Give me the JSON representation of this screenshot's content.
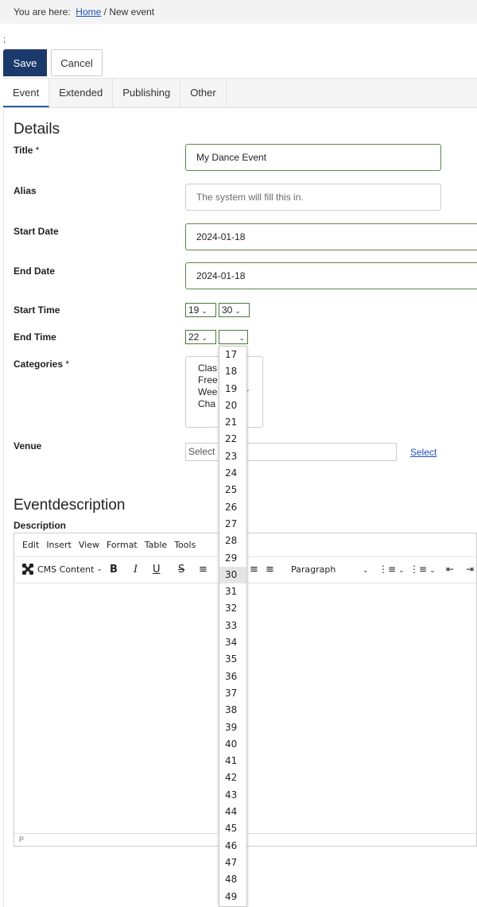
{
  "breadcrumb": {
    "prefix": "You are here:",
    "home": "Home",
    "separator": "/",
    "current": "New event"
  },
  "stray_text": ";",
  "toolbar": {
    "save_label": "Save",
    "cancel_label": "Cancel"
  },
  "tabs": [
    {
      "label": "Event",
      "active": true
    },
    {
      "label": "Extended",
      "active": false
    },
    {
      "label": "Publishing",
      "active": false
    },
    {
      "label": "Other",
      "active": false
    }
  ],
  "details": {
    "section_title": "Details",
    "title": {
      "label": "Title",
      "required_mark": "*",
      "value": "My Dance Event"
    },
    "alias": {
      "label": "Alias",
      "placeholder": "The system will fill this in."
    },
    "start_date": {
      "label": "Start Date",
      "value": "2024-01-18"
    },
    "end_date": {
      "label": "End Date",
      "value": "2024-01-18"
    },
    "start_time": {
      "label": "Start Time",
      "hour": "19",
      "minute": "30"
    },
    "end_time": {
      "label": "End Time",
      "hour": "22",
      "minute": ""
    },
    "categories": {
      "label": "Categories",
      "required_mark": "*",
      "items": [
        "Clas",
        "Free",
        "Wee",
        "Cha"
      ],
      "overflow_text": "r"
    },
    "venue": {
      "label": "Venue",
      "placeholder": "Select",
      "select_link": "Select"
    }
  },
  "description": {
    "section_title": "Eventdescription",
    "label": "Description",
    "menubar": [
      "Edit",
      "Insert",
      "View",
      "Format",
      "Table",
      "Tools"
    ],
    "toolbar": {
      "cms_content": "CMS Content",
      "bold": "B",
      "italic": "I",
      "underline": "U",
      "strike": "S",
      "paragraph": "Paragraph"
    },
    "status_path": "P"
  },
  "minute_dropdown": {
    "options": [
      "17",
      "18",
      "19",
      "20",
      "21",
      "22",
      "23",
      "24",
      "25",
      "26",
      "27",
      "28",
      "29",
      "30",
      "31",
      "32",
      "33",
      "34",
      "35",
      "36",
      "37",
      "38",
      "39",
      "40",
      "41",
      "42",
      "43",
      "44",
      "45",
      "46",
      "47",
      "48",
      "49"
    ],
    "highlighted": "30"
  },
  "colors": {
    "save_button": "#1b3a6b",
    "valid_border": "#5a8a4a",
    "link": "#1f4fbf",
    "tab_active_indicator": "#2a5ea5"
  },
  "icons": {
    "cms_content": "joomla-logo-icon",
    "chevron": "chevron-down-icon"
  }
}
